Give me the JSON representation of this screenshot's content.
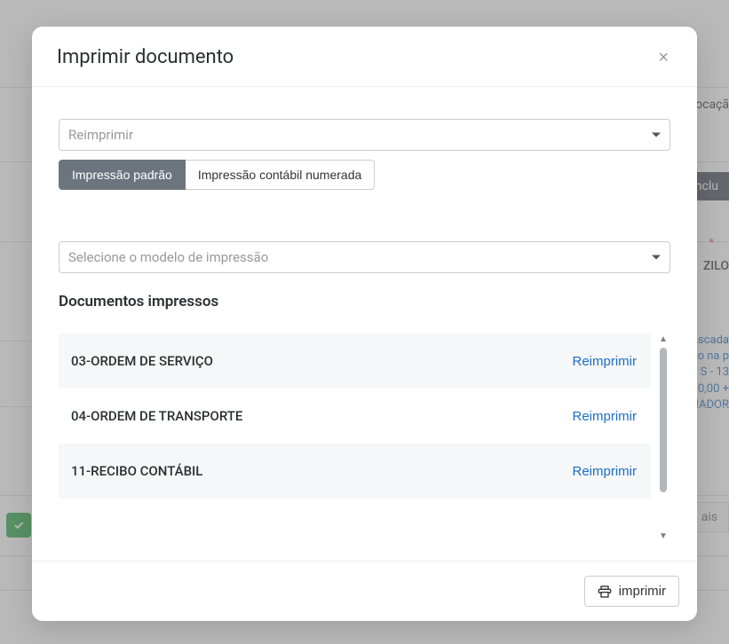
{
  "modal": {
    "title": "Imprimir documento",
    "close_label": "×",
    "select1": {
      "placeholder": "Reimprimir"
    },
    "tabs": {
      "padrao": "Impressão padrão",
      "contabil": "Impressão contábil numerada"
    },
    "select2": {
      "placeholder": "Selecione o modelo de impressão"
    },
    "docs_heading": "Documentos impressos",
    "reprint_label": "Reimprimir",
    "documents": [
      {
        "name": "03-ORDEM DE SERVIÇO"
      },
      {
        "name": "04-ORDEM DE TRANSPORTE"
      },
      {
        "name": "11-RECIBO CONTÁBIL"
      }
    ],
    "footer": {
      "print_label": "imprimir"
    }
  },
  "background": {
    "locacao_fragment": "ocaçã",
    "incl_fragment": "inclu",
    "asterisk": "*",
    "cliente_fragment": "ZILO",
    "blue_lines": [
      "Escada",
      "to na p",
      "S - 13",
      "0,00 +",
      "IADOR"
    ],
    "ais_fragment": "ais"
  }
}
